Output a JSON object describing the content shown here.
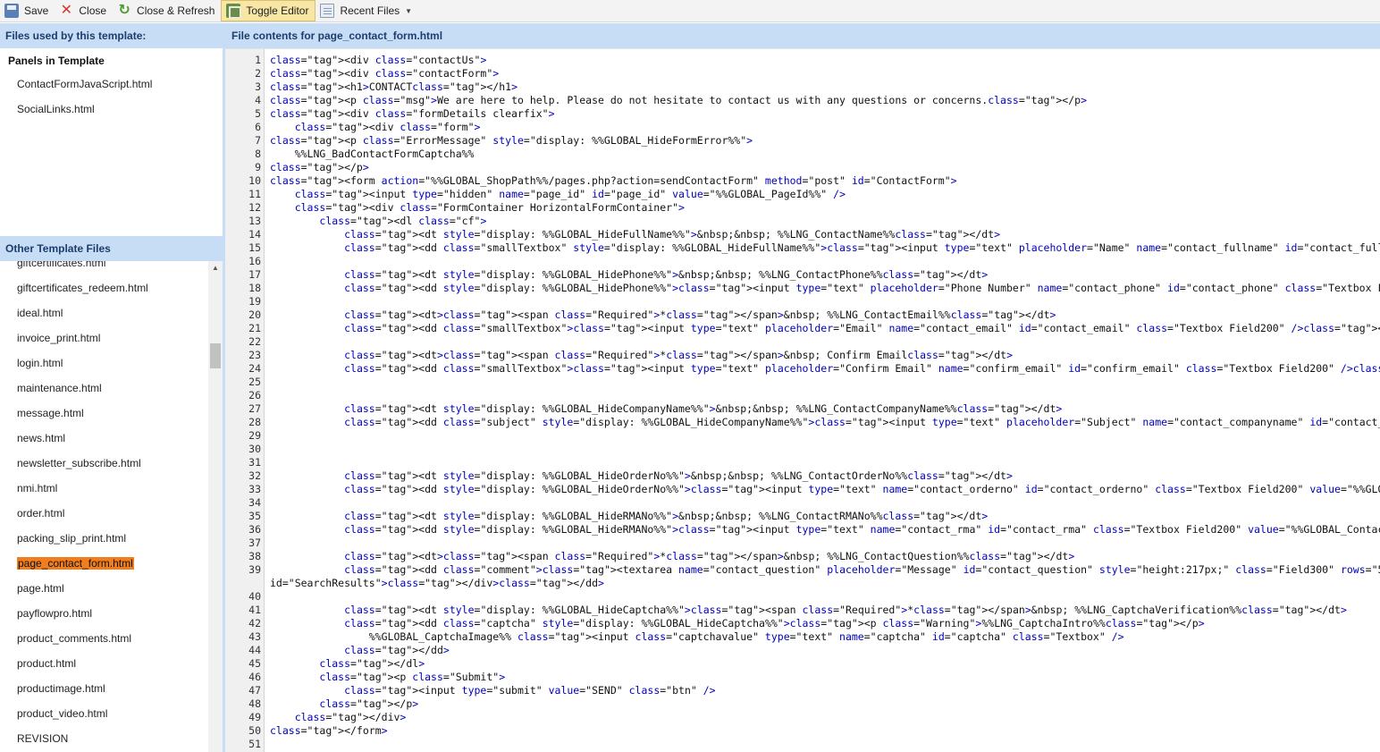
{
  "toolbar": {
    "save_label": "Save",
    "close_label": "Close",
    "close_refresh_label": "Close & Refresh",
    "toggle_editor_label": "Toggle Editor",
    "recent_files_label": "Recent Files",
    "icons": [
      "save-icon",
      "close-icon",
      "refresh-icon",
      "toggle-editor-icon",
      "recent-files-icon"
    ]
  },
  "left_panel": {
    "header": "Files used by this template:",
    "panels_heading": "Panels in Template",
    "panels": [
      "ContactFormJavaScript.html",
      "SocialLinks.html"
    ],
    "other_header": "Other Template Files",
    "other_files": [
      "giftcertificates.html",
      "giftcertificates_redeem.html",
      "ideal.html",
      "invoice_print.html",
      "login.html",
      "maintenance.html",
      "message.html",
      "news.html",
      "newsletter_subscribe.html",
      "nmi.html",
      "order.html",
      "packing_slip_print.html",
      "page_contact_form.html",
      "page.html",
      "payflowpro.html",
      "product_comments.html",
      "product.html",
      "productimage.html",
      "product_video.html",
      "REVISION"
    ],
    "selected_file": "page_contact_form.html",
    "selected_color": "#f07d1e"
  },
  "editor": {
    "header": "File contents for page_contact_form.html",
    "lines": [
      "<div class=\"contactUs\">",
      "<div class=\"contactForm\">",
      "<h1>CONTACT</h1>",
      "<p class=\"msg\">We are here to help. Please do not hesitate to contact us with any questions or concerns.</p>",
      "<div class=\"formDetails clearfix\">",
      "    <div class=\"form\">",
      "<p class=\"ErrorMessage\" style=\"display: %%GLOBAL_HideFormError%%\">",
      "    %%LNG_BadContactFormCaptcha%%",
      "</p>",
      "<form action=\"%%GLOBAL_ShopPath%%/pages.php?action=sendContactForm\" method=\"post\" id=\"ContactForm\">",
      "    <input type=\"hidden\" name=\"page_id\" id=\"page_id\" value=\"%%GLOBAL_PageId%%\" />",
      "    <div class=\"FormContainer HorizontalFormContainer\">",
      "        <dl class=\"cf\">",
      "            <dt style=\"display: %%GLOBAL_HideFullName%%\">&nbsp;&nbsp; %%LNG_ContactName%%</dt>",
      "            <dd class=\"smallTextbox\" style=\"display: %%GLOBAL_HideFullName%%\"><input type=\"text\" placeholder=\"Name\" name=\"contact_fullname\" id=\"contact_fullname\" class=\"Te",
      "",
      "            <dt style=\"display: %%GLOBAL_HidePhone%%\">&nbsp;&nbsp; %%LNG_ContactPhone%%</dt>",
      "            <dd style=\"display: %%GLOBAL_HidePhone%%\"><input type=\"text\" placeholder=\"Phone Number\" name=\"contact_phone\" id=\"contact_phone\" class=\"Textbox Field200\" value",
      "",
      "            <dt><span class=\"Required\">*</span>&nbsp; %%LNG_ContactEmail%%</dt>",
      "            <dd class=\"smallTextbox\"><input type=\"text\" placeholder=\"Email\" name=\"contact_email\" id=\"contact_email\" class=\"Textbox Field200\" /></dd>",
      "",
      "            <dt><span class=\"Required\">*</span>&nbsp; Confirm Email</dt>",
      "            <dd class=\"smallTextbox\"><input type=\"text\" placeholder=\"Confirm Email\" name=\"confirm_email\" id=\"confirm_email\" class=\"Textbox Field200\" /></dd>",
      "",
      "",
      "            <dt style=\"display: %%GLOBAL_HideCompanyName%%\">&nbsp;&nbsp; %%LNG_ContactCompanyName%%</dt>",
      "            <dd class=\"subject\" style=\"display: %%GLOBAL_HideCompanyName%%\"><input type=\"text\" placeholder=\"Subject\" name=\"contact_companyname\" id=\"contact_companyname\" c",
      "",
      "",
      "",
      "            <dt style=\"display: %%GLOBAL_HideOrderNo%%\">&nbsp;&nbsp; %%LNG_ContactOrderNo%%</dt>",
      "            <dd style=\"display: %%GLOBAL_HideOrderNo%%\"><input type=\"text\" name=\"contact_orderno\" id=\"contact_orderno\" class=\"Textbox Field200\" value=\"%%GLOBAL_ContactOrd",
      "",
      "            <dt style=\"display: %%GLOBAL_HideRMANo%%\">&nbsp;&nbsp; %%LNG_ContactRMANo%%</dt>",
      "            <dd style=\"display: %%GLOBAL_HideRMANo%%\"><input type=\"text\" name=\"contact_rma\" id=\"contact_rma\" class=\"Textbox Field200\" value=\"%%GLOBAL_ContactRMA%%\" /></dd",
      "",
      "            <dt><span class=\"Required\">*</span>&nbsp; %%LNG_ContactQuestion%%</dt>",
      "            <dd class=\"comment\"><textarea name=\"contact_question\" placeholder=\"Message\" id=\"contact_question\" style=\"height:217px;\" class=\"Field300\" rows=\"5\" cols=\"50\">%%",
      "id=\"SearchResults\"></div></dd>",
      "",
      "            <dt style=\"display: %%GLOBAL_HideCaptcha%%\"><span class=\"Required\">*</span>&nbsp; %%LNG_CaptchaVerification%%</dt>",
      "            <dd class=\"captcha\" style=\"display: %%GLOBAL_HideCaptcha%%\"><p class=\"Warning\">%%LNG_CaptchaIntro%%</p>",
      "                %%GLOBAL_CaptchaImage%% <input class=\"captchavalue\" type=\"text\" name=\"captcha\" id=\"captcha\" class=\"Textbox\" />",
      "            </dd>",
      "        </dl>",
      "        <p class=\"Submit\">",
      "            <input type=\"submit\" value=\"SEND\" class=\"btn\" />",
      "        </p>",
      "    </div>",
      "</form>",
      ""
    ],
    "line_numbers": [
      "1",
      "2",
      "3",
      "4",
      "5",
      "6",
      "7",
      "8",
      "9",
      "10",
      "11",
      "12",
      "13",
      "14",
      "15",
      "16",
      "17",
      "18",
      "19",
      "20",
      "21",
      "22",
      "23",
      "24",
      "25",
      "26",
      "27",
      "28",
      "29",
      "30",
      "31",
      "32",
      "33",
      "34",
      "35",
      "36",
      "37",
      "38",
      "39",
      "",
      "40",
      "41",
      "42",
      "43",
      "44",
      "45",
      "46",
      "47",
      "48",
      "49",
      "50",
      "51"
    ]
  }
}
